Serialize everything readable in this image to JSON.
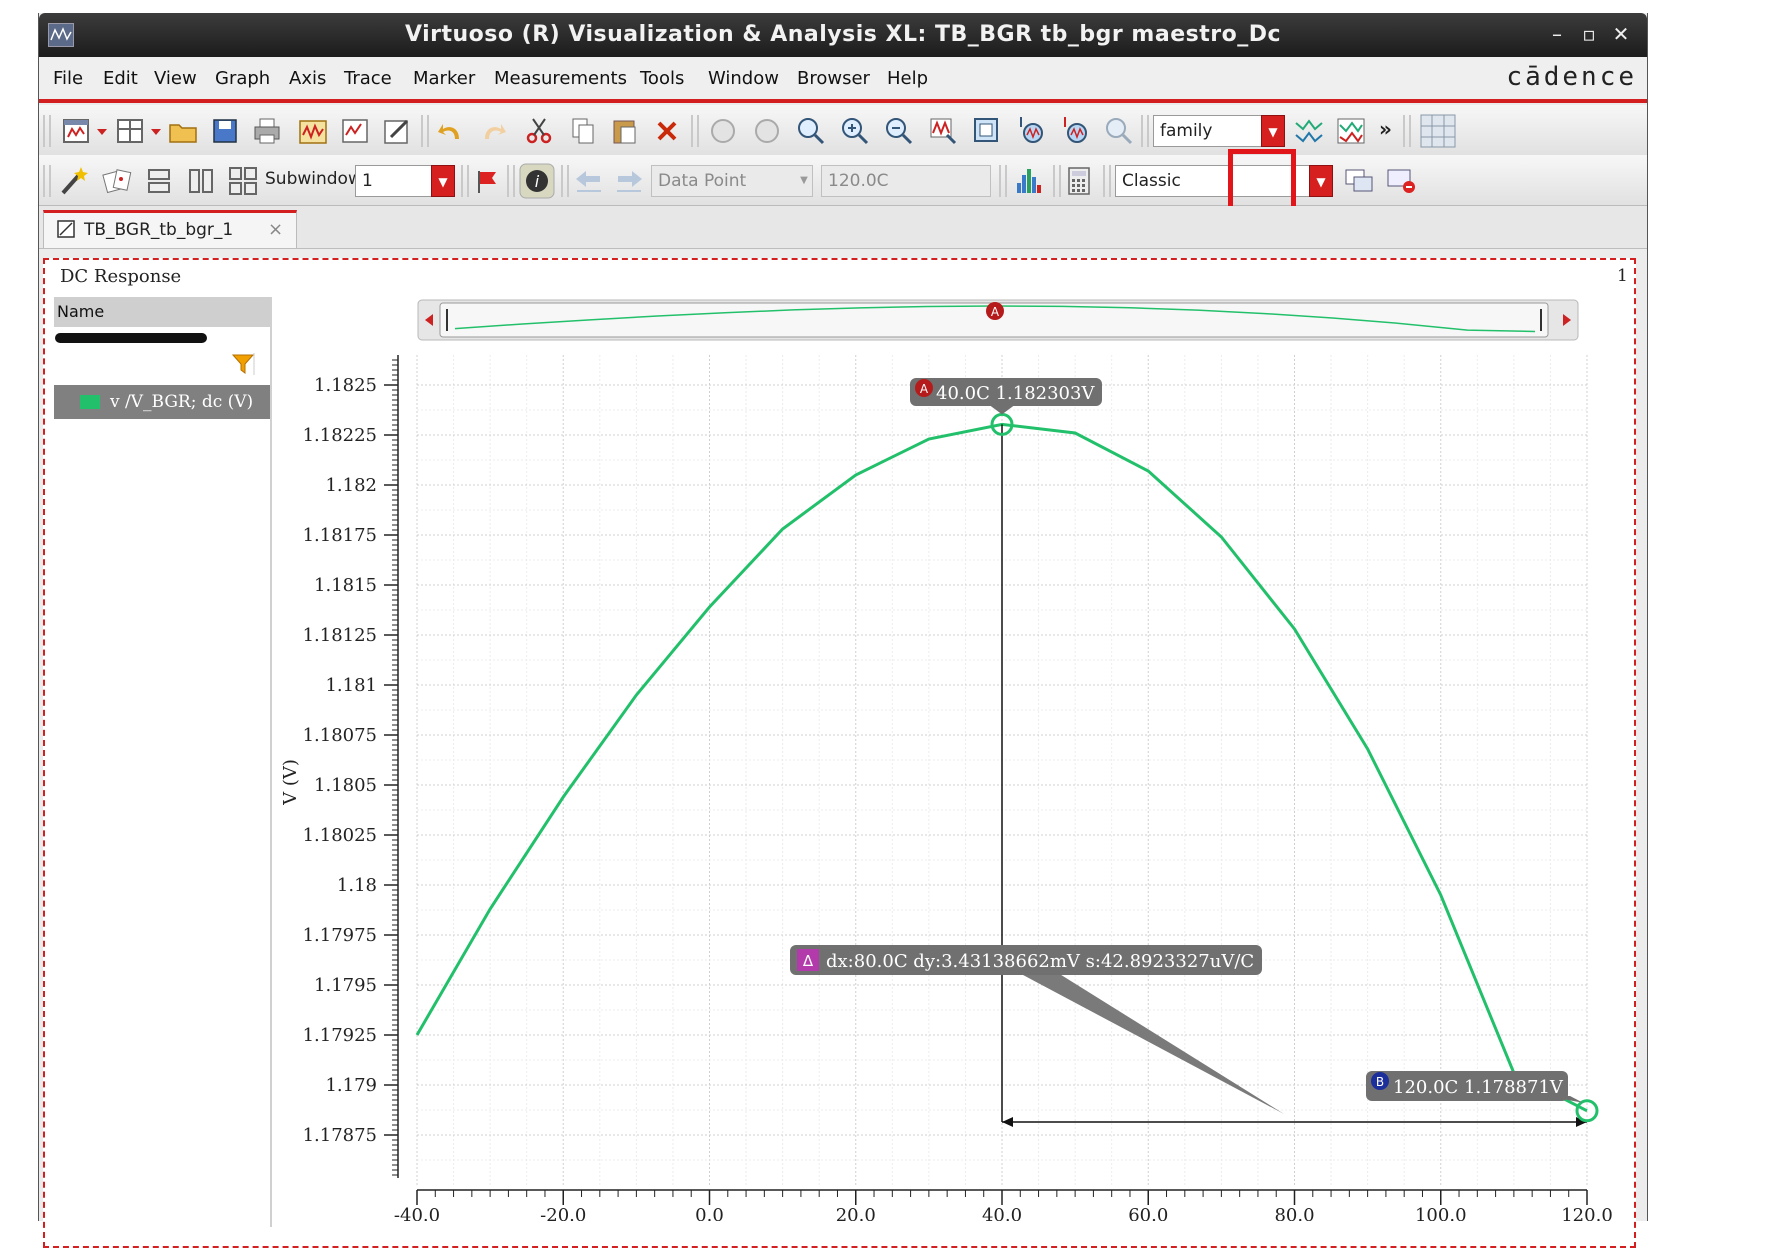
{
  "window": {
    "title": "Virtuoso (R) Visualization & Analysis XL: TB_BGR tb_bgr maestro_Dc",
    "controls": {
      "minimize": "–",
      "maximize": "▫",
      "close": "✕"
    }
  },
  "menubar": {
    "items": [
      "File",
      "Edit",
      "View",
      "Graph",
      "Axis",
      "Trace",
      "Marker",
      "Measurements",
      "Tools",
      "Window",
      "Browser",
      "Help"
    ],
    "brand": "cādence"
  },
  "toolbar1": {
    "family_value": "family",
    "overflow": "»"
  },
  "toolbar2": {
    "subwindow_label": "Subwindow:",
    "subwindow_value": "1",
    "data_point_value": "Data Point",
    "x_value": "120.0C",
    "style_value": "Classic"
  },
  "tabs": [
    {
      "label": "TB_BGR_tb_bgr_1",
      "close": "×"
    }
  ],
  "subwindow": {
    "title": "DC Response",
    "number": "1"
  },
  "legend": {
    "header": "Name",
    "items": [
      {
        "label": "v /V_BGR; dc (V)",
        "color": "#22c06a"
      }
    ]
  },
  "chart_data": {
    "type": "line",
    "ylabel": "V (V)",
    "xlim": [
      -40,
      120
    ],
    "ylim": [
      1.1785,
      1.18275
    ],
    "x_ticks": [
      "-40.0",
      "-20.0",
      "0.0",
      "20.0",
      "40.0",
      "60.0",
      "80.0",
      "100.0",
      "120.0"
    ],
    "y_ticks": [
      "1.1825",
      "1.18225",
      "1.182",
      "1.18175",
      "1.1815",
      "1.18125",
      "1.181",
      "1.18075",
      "1.1805",
      "1.18025",
      "1.18",
      "1.17975",
      "1.1795",
      "1.17925",
      "1.179",
      "1.17875"
    ],
    "grid": true,
    "series": [
      {
        "name": "v /V_BGR; dc (V)",
        "color": "#22c06a",
        "x": [
          -40,
          -30,
          -20,
          -10,
          0,
          10,
          20,
          30,
          40,
          50,
          60,
          70,
          80,
          90,
          100,
          110,
          120
        ],
        "y": [
          1.17925,
          1.17988,
          1.18044,
          1.18095,
          1.18139,
          1.18178,
          1.18205,
          1.18223,
          1.182303,
          1.18226,
          1.18207,
          1.18174,
          1.18128,
          1.18068,
          1.17995,
          1.17906,
          1.178871
        ]
      }
    ],
    "markers": [
      {
        "id": "A",
        "x": 40.0,
        "y": 1.182303,
        "label": "40.0C 1.182303V",
        "color": "#b61b1b"
      },
      {
        "id": "B",
        "x": 120.0,
        "y": 1.178871,
        "label": "120.0C 1.178871V",
        "color": "#1d2f9a"
      }
    ],
    "delta": {
      "symbol": "Δ",
      "label": "dx:80.0C dy:3.43138662mV s:42.8923327uV/C"
    }
  }
}
